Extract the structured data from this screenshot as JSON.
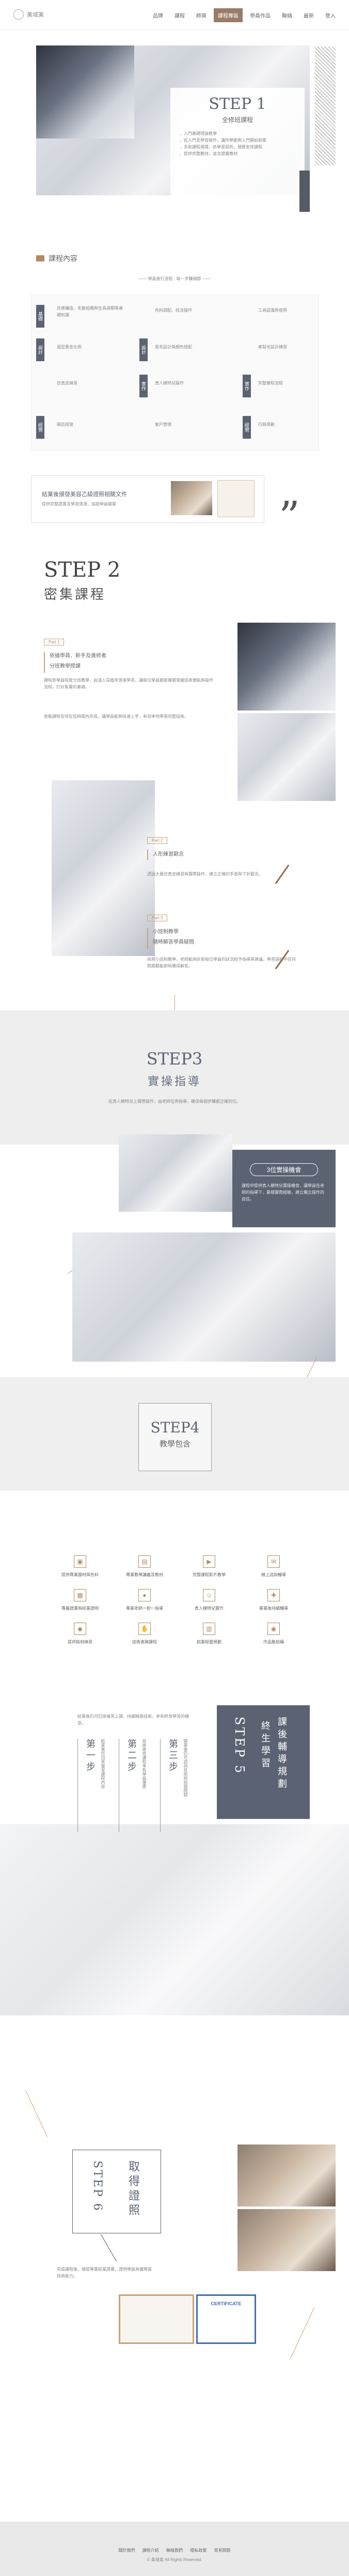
{
  "nav": {
    "brand": "美域美",
    "items": [
      "品牌",
      "課程",
      "師資",
      "課程專區",
      "學員作品",
      "聯絡",
      "最新",
      "登入"
    ],
    "active_index": 3
  },
  "step1": {
    "title": "STEP 1",
    "subtitle": "全修班課程",
    "bullets": [
      "．入門基礎理論教學",
      "．從入門至學會操作，讓所學能夠入門開始創業",
      "．多款課程選擇，依學習目的、預算安排課程",
      "．提供完整教材，並含證書教材"
    ]
  },
  "course": {
    "heading": "課程內容",
    "note": "—— 學員進行流程 · 每一步驟細節 ——",
    "rows": [
      {
        "tag": "基礎",
        "items": [
          "皮膚構造、毛髮組織與生長週期等基礎知識",
          "色料調配、技法操作",
          "工具認識與使用"
        ]
      },
      {
        "tag": "設計",
        "items": [
          "眉型黃金比例",
          "眉毛設計與顏色搭配",
          "客製化設計練習"
        ]
      },
      {
        "tag": "實作",
        "items": [
          "仿真皮練習",
          "真人模特兒操作",
          "完整療程流程"
        ]
      },
      {
        "tag": "經營",
        "items": [
          "開店經營",
          "客戶管理",
          "行銷規劃"
        ]
      }
    ]
  },
  "cert_banner": {
    "text": "結業後頒發美容乙級證照相關文件",
    "sub": "提供完整證書及學習資源，協助學員開業"
  },
  "step2": {
    "title": "STEP 2",
    "subtitle": "密集課程",
    "tag1": "Part 1",
    "h1": "依據學員、新手及進修者",
    "h2": "分班教學授課",
    "para": "課程依學員程度分班教學，由淺入深循序漸進學習，讓每位學員都能確實掌握技術要點與操作流程，打好紮實的基礎。",
    "para2": "密集課程安排在短時間內完成，讓學員能夠快速上手，有效率地學習完整技術。",
    "tag2": "Part 2",
    "h3": "人形練習觀念",
    "para3": "透過大量仿真皮練習與實際操作，建立正確的手感與下針觀念。",
    "tag3": "Part 3",
    "h4": "小班制教學",
    "h5": "隨時解答學員疑問",
    "para4": "採用小班制教學，老師能夠針對每位學員的狀況給予指導與建議，學習過程中任何問題都能即時獲得解答。"
  },
  "step3": {
    "title": "STEP3",
    "subtitle": "實操指導",
    "desc": "在真人模特兒上實際操作，由老師在旁指導，確保每個步驟都正確到位。",
    "box_title": "3位實操機會",
    "box_text": "課程中提供真人模特兒實操機會，讓學員在老師的指導下，累積實際經驗，建立獨立操作的自信。"
  },
  "step4": {
    "title": "STEP4",
    "subtitle": "教學包含",
    "items": [
      "提供專業器材與色料",
      "專業教學講義及教材",
      "完整課程影片教學",
      "線上諮詢輔導",
      "專屬證書與結業證明",
      "專業老師一對一指導",
      "真人模特兒實作",
      "畢業後持續輔導",
      "提供耗材練習",
      "技術進階課程",
      "創業經營規劃",
      "作品集拍攝"
    ]
  },
  "step5": {
    "title": "STEP 5",
    "vtext1": "課後輔導規劃",
    "vtext2": "終生學習",
    "intro": "結業後仍可回來複習上課，持續精進技術，享有終身學習的機會。",
    "cols": [
      {
        "head": "第一步",
        "body": "結業後可回來複習課程內容"
      },
      {
        "head": "第二步",
        "body": "技術進修課程享有學員優惠"
      },
      {
        "head": "第三步",
        "body": "開業後仍可諮詢技術與經營問題"
      }
    ]
  },
  "step6": {
    "title": "STEP 6",
    "vtext": "取得證照",
    "caption": "完成課程後，頒發專業結業證書，證明學員具備專業技術能力。",
    "cert_label": "CERTIFICATE"
  },
  "footer": {
    "links": [
      "關於我們",
      "課程介紹",
      "聯絡我們",
      "隱私政策",
      "常見問題"
    ],
    "copyright": "© 美域美 All Rights Reserved."
  }
}
